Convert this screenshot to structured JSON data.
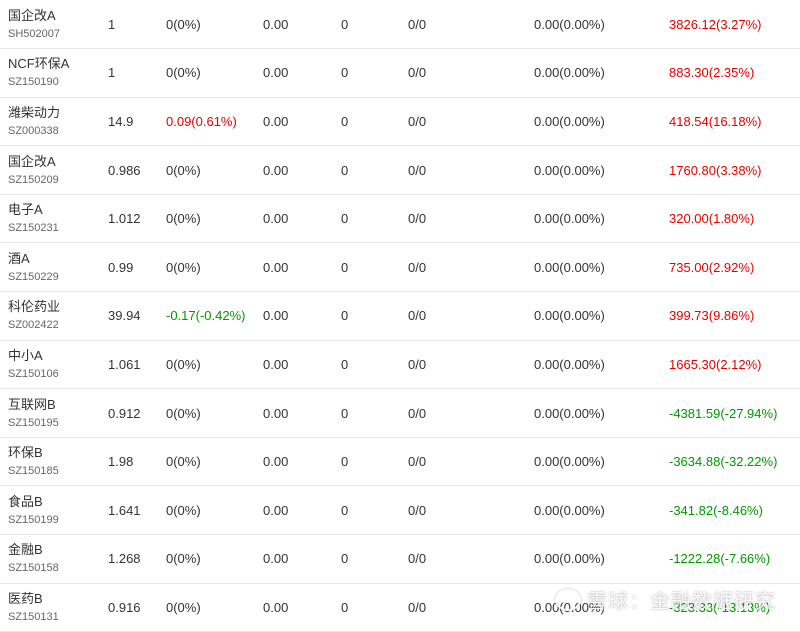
{
  "colors": {
    "up": "#e60000",
    "down": "#009900",
    "text": "#333333",
    "code": "#666666"
  },
  "rows": [
    {
      "name": "国企改A",
      "code": "SH502007",
      "price": "1",
      "change": "0(0%)",
      "change_dir": "flat",
      "c4": "0.00",
      "c5": "0",
      "c6": "0/0",
      "c7": "0.00(0.00%)",
      "last": "3826.12(3.27%)",
      "last_dir": "up"
    },
    {
      "name": "NCF环保A",
      "code": "SZ150190",
      "price": "1",
      "change": "0(0%)",
      "change_dir": "flat",
      "c4": "0.00",
      "c5": "0",
      "c6": "0/0",
      "c7": "0.00(0.00%)",
      "last": "883.30(2.35%)",
      "last_dir": "up"
    },
    {
      "name": "潍柴动力",
      "code": "SZ000338",
      "price": "14.9",
      "change": "0.09(0.61%)",
      "change_dir": "up",
      "c4": "0.00",
      "c5": "0",
      "c6": "0/0",
      "c7": "0.00(0.00%)",
      "last": "418.54(16.18%)",
      "last_dir": "up"
    },
    {
      "name": "国企改A",
      "code": "SZ150209",
      "price": "0.986",
      "change": "0(0%)",
      "change_dir": "flat",
      "c4": "0.00",
      "c5": "0",
      "c6": "0/0",
      "c7": "0.00(0.00%)",
      "last": "1760.80(3.38%)",
      "last_dir": "up"
    },
    {
      "name": "电子A",
      "code": "SZ150231",
      "price": "1.012",
      "change": "0(0%)",
      "change_dir": "flat",
      "c4": "0.00",
      "c5": "0",
      "c6": "0/0",
      "c7": "0.00(0.00%)",
      "last": "320.00(1.80%)",
      "last_dir": "up"
    },
    {
      "name": "酒A",
      "code": "SZ150229",
      "price": "0.99",
      "change": "0(0%)",
      "change_dir": "flat",
      "c4": "0.00",
      "c5": "0",
      "c6": "0/0",
      "c7": "0.00(0.00%)",
      "last": "735.00(2.92%)",
      "last_dir": "up"
    },
    {
      "name": "科伦药业",
      "code": "SZ002422",
      "price": "39.94",
      "change": "-0.17(-0.42%)",
      "change_dir": "down",
      "c4": "0.00",
      "c5": "0",
      "c6": "0/0",
      "c7": "0.00(0.00%)",
      "last": "399.73(9.86%)",
      "last_dir": "up"
    },
    {
      "name": "中小A",
      "code": "SZ150106",
      "price": "1.061",
      "change": "0(0%)",
      "change_dir": "flat",
      "c4": "0.00",
      "c5": "0",
      "c6": "0/0",
      "c7": "0.00(0.00%)",
      "last": "1665.30(2.12%)",
      "last_dir": "up"
    },
    {
      "name": "互联网B",
      "code": "SZ150195",
      "price": "0.912",
      "change": "0(0%)",
      "change_dir": "flat",
      "c4": "0.00",
      "c5": "0",
      "c6": "0/0",
      "c7": "0.00(0.00%)",
      "last": "-4381.59(-27.94%)",
      "last_dir": "down"
    },
    {
      "name": "环保B",
      "code": "SZ150185",
      "price": "1.98",
      "change": "0(0%)",
      "change_dir": "flat",
      "c4": "0.00",
      "c5": "0",
      "c6": "0/0",
      "c7": "0.00(0.00%)",
      "last": "-3634.88(-32.22%)",
      "last_dir": "down"
    },
    {
      "name": "食品B",
      "code": "SZ150199",
      "price": "1.641",
      "change": "0(0%)",
      "change_dir": "flat",
      "c4": "0.00",
      "c5": "0",
      "c6": "0/0",
      "c7": "0.00(0.00%)",
      "last": "-341.82(-8.46%)",
      "last_dir": "down"
    },
    {
      "name": "金融B",
      "code": "SZ150158",
      "price": "1.268",
      "change": "0(0%)",
      "change_dir": "flat",
      "c4": "0.00",
      "c5": "0",
      "c6": "0/0",
      "c7": "0.00(0.00%)",
      "last": "-1222.28(-7.66%)",
      "last_dir": "down"
    },
    {
      "name": "医药B",
      "code": "SZ150131",
      "price": "0.916",
      "change": "0(0%)",
      "change_dir": "flat",
      "c4": "0.00",
      "c5": "0",
      "c6": "0/0",
      "c7": "0.00(0.00%)",
      "last": "-323.33(-13.13%)",
      "last_dir": "down"
    }
  ],
  "watermark": {
    "text": "雪球：金融数据研究",
    "icon": "snowball-logo-icon"
  }
}
